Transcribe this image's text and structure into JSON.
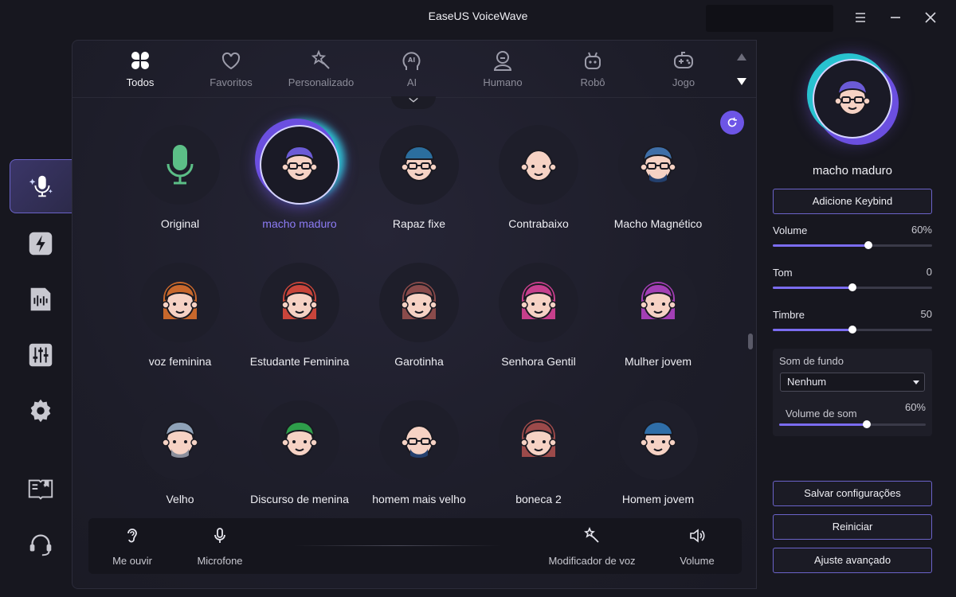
{
  "window": {
    "title": "EaseUS VoiceWave"
  },
  "categories": [
    {
      "label": "Todos",
      "icon": "four-leaf-grid-icon",
      "active": true
    },
    {
      "label": "Favoritos",
      "icon": "heart-icon"
    },
    {
      "label": "Personalizado",
      "icon": "star-wand-icon"
    },
    {
      "label": "AI",
      "icon": "ai-head-icon"
    },
    {
      "label": "Humano",
      "icon": "person-icon"
    },
    {
      "label": "Robô",
      "icon": "robot-icon"
    },
    {
      "label": "Jogo",
      "icon": "gamepad-icon"
    }
  ],
  "voices": [
    {
      "name": "Original",
      "avatar": "microphone"
    },
    {
      "name": "macho maduro",
      "avatar": "man-purple-glasses",
      "selected": true
    },
    {
      "name": "Rapaz fixe",
      "avatar": "boy-cap-glasses"
    },
    {
      "name": "Contrabaixo",
      "avatar": "bald-man"
    },
    {
      "name": "Macho Magnético",
      "avatar": "man-beard-glasses"
    },
    {
      "name": "voz feminina",
      "avatar": "woman-orange-hair"
    },
    {
      "name": "Estudante Feminina",
      "avatar": "woman-red-hair"
    },
    {
      "name": "Garotinha",
      "avatar": "girl-brown-hair"
    },
    {
      "name": "Senhora Gentil",
      "avatar": "lady-pink-hair"
    },
    {
      "name": "Mulher jovem",
      "avatar": "young-woman-purple-hair"
    },
    {
      "name": "Velho",
      "avatar": "old-man"
    },
    {
      "name": "Discurso de menina",
      "avatar": "girl-green-hair"
    },
    {
      "name": "homem mais velho",
      "avatar": "bald-man-glasses"
    },
    {
      "name": "boneca 2",
      "avatar": "doll-braids"
    },
    {
      "name": "Homem jovem",
      "avatar": "young-man-cap"
    }
  ],
  "bottom_bar": {
    "listen_label": "Me ouvir",
    "mic_label": "Microfone",
    "modifier_label": "Modificador de voz",
    "volume_label": "Volume"
  },
  "right_panel": {
    "selected_name": "macho maduro",
    "keybind_label": "Adicione Keybind",
    "volume": {
      "label": "Volume",
      "value_text": "60%",
      "value": 0.6
    },
    "tone": {
      "label": "Tom",
      "value_text": "0",
      "value": 0.5
    },
    "timbre": {
      "label": "Timbre",
      "value_text": "50",
      "value": 0.5
    },
    "background": {
      "label": "Som de fundo",
      "selected": "Nenhum",
      "volume_label": "Volume de som",
      "volume_text": "60%",
      "volume_value": 0.6
    },
    "save_label": "Salvar configurações",
    "reset_label": "Reiniciar",
    "advanced_label": "Ajuste avançado"
  },
  "colors": {
    "accent": "#7b6cf0",
    "selected_text": "#8d7cf5",
    "background": "#17171f"
  }
}
